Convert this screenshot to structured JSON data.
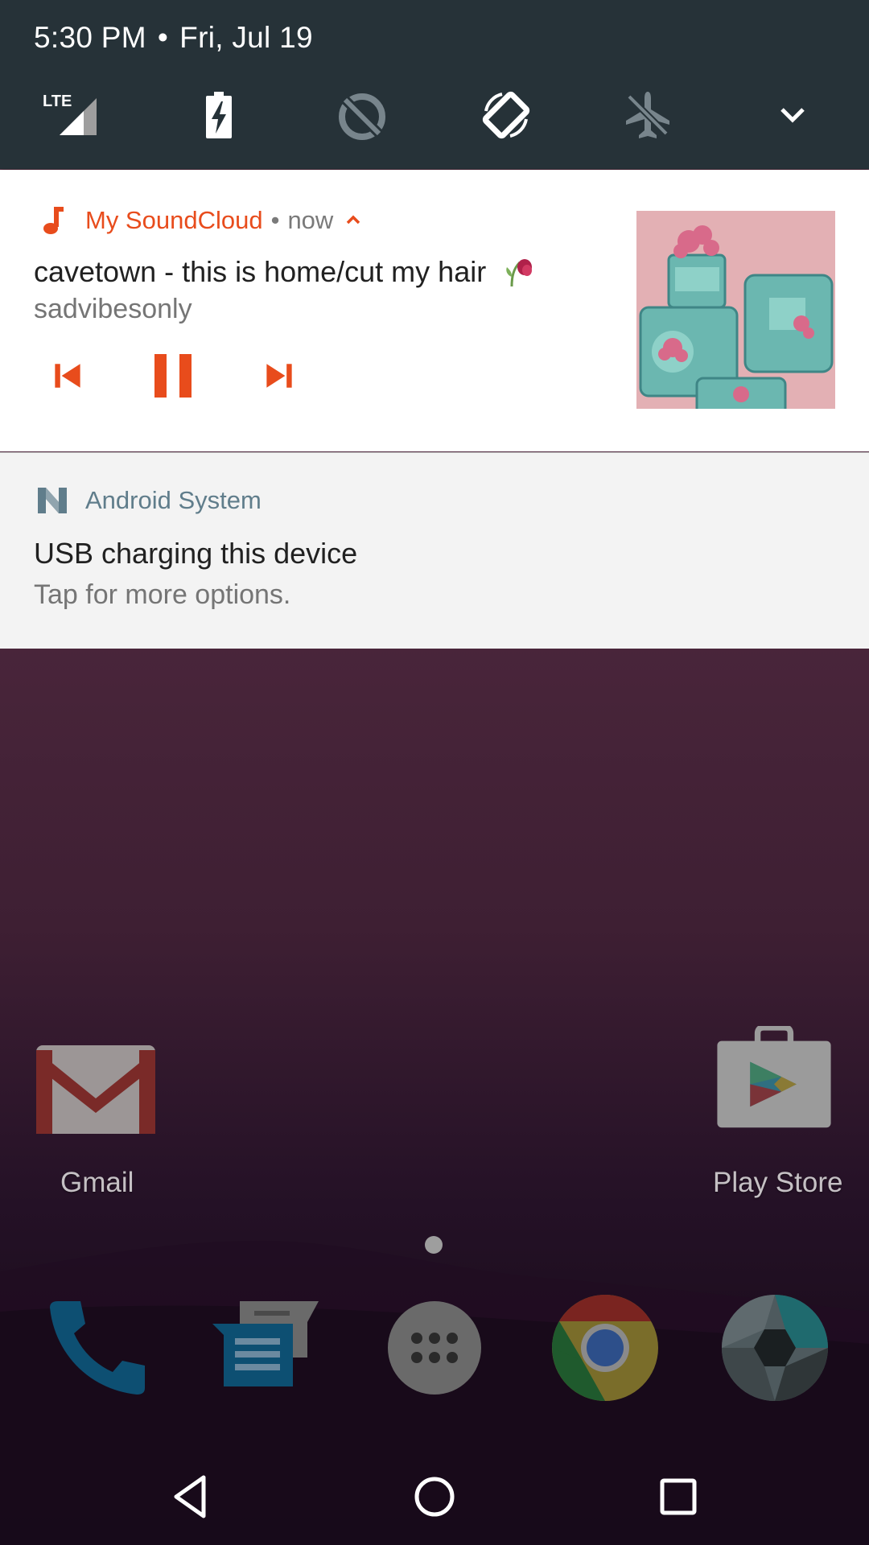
{
  "status": {
    "time": "5:30 PM",
    "separator": "•",
    "date": "Fri, Jul 19"
  },
  "quick_settings": {
    "tiles": [
      {
        "icon": "lte-signal-icon",
        "label": "LTE",
        "active": true
      },
      {
        "icon": "battery-charging-icon",
        "active": true
      },
      {
        "icon": "data-saver-off-icon",
        "active": false
      },
      {
        "icon": "auto-rotate-icon",
        "active": true
      },
      {
        "icon": "airplane-mode-icon",
        "active": false
      },
      {
        "icon": "expand-chevron-icon",
        "active": true
      }
    ]
  },
  "media_notification": {
    "app_name": "My SoundCloud",
    "separator": "•",
    "time": "now",
    "title": "cavetown - this is home/cut my hair",
    "subtitle": "sadvibesonly",
    "accent_color": "#e84c1c",
    "controls": [
      "previous-icon",
      "pause-icon",
      "next-icon"
    ]
  },
  "system_notification": {
    "app_name": "Android System",
    "title": "USB charging this device",
    "text": "Tap for more options."
  },
  "home": {
    "apps": [
      {
        "label": "Gmail",
        "icon": "gmail-icon"
      },
      {
        "label": "Play Store",
        "icon": "play-store-icon"
      }
    ],
    "dock": [
      "phone-icon",
      "messages-icon",
      "app-drawer-icon",
      "chrome-icon",
      "camera-icon"
    ]
  },
  "navbar": [
    "back-icon",
    "home-icon",
    "recents-icon"
  ]
}
